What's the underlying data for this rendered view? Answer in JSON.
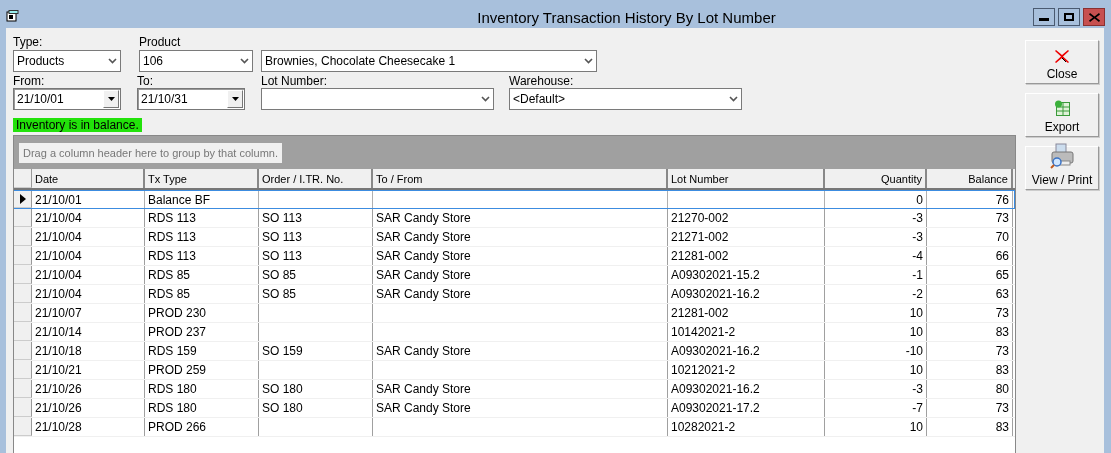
{
  "window": {
    "title": "Inventory Transaction History By Lot Number"
  },
  "filters": [
    [
      {
        "kind": "dropdown",
        "label": "Type:",
        "value": "Products"
      },
      {
        "kind": "dropdown",
        "label": "Product",
        "value": "106"
      },
      {
        "kind": "dropdown",
        "value": "Brownies, Chocolate Cheesecake 1"
      }
    ],
    [
      {
        "kind": "date",
        "label": "From:",
        "value": "21/10/01"
      },
      {
        "kind": "date",
        "label": "To:",
        "value": "21/10/31"
      },
      {
        "kind": "dropdown",
        "label": "Lot Number:"
      },
      {
        "kind": "dropdown",
        "label": "Warehouse:",
        "value": "<Default>"
      }
    ]
  ],
  "status": {
    "text": "Inventory is in balance.",
    "color": "#22e20a"
  },
  "grid": {
    "group_hint": "Drag a column header here to group by that column.",
    "columns": [
      {
        "label": "Date"
      },
      {
        "label": "Tx Type"
      },
      {
        "label": "Order / I.TR. No."
      },
      {
        "label": "To / From"
      },
      {
        "label": "Lot Number"
      },
      {
        "label": "Quantity"
      },
      {
        "label": "Balance"
      }
    ],
    "rows": [
      {
        "current": true,
        "cells": [
          "21/10/01",
          "Balance BF",
          null,
          null,
          null,
          "0",
          "76"
        ]
      },
      {
        "current": false,
        "cells": [
          "21/10/04",
          "RDS 113",
          "SO 113",
          "SAR Candy Store",
          "21270-002",
          "-3",
          "73"
        ]
      },
      {
        "current": false,
        "cells": [
          "21/10/04",
          "RDS 113",
          "SO 113",
          "SAR Candy Store",
          "21271-002",
          "-3",
          "70"
        ]
      },
      {
        "current": false,
        "cells": [
          "21/10/04",
          "RDS 113",
          "SO 113",
          "SAR Candy Store",
          "21281-002",
          "-4",
          "66"
        ]
      },
      {
        "current": false,
        "cells": [
          "21/10/04",
          "RDS 85",
          "SO 85",
          "SAR Candy Store",
          "A09302021-15.2",
          "-1",
          "65"
        ]
      },
      {
        "current": false,
        "cells": [
          "21/10/04",
          "RDS 85",
          "SO 85",
          "SAR Candy Store",
          "A09302021-16.2",
          "-2",
          "63"
        ]
      },
      {
        "current": false,
        "cells": [
          "21/10/07",
          "PROD 230",
          null,
          null,
          "21281-002",
          "10",
          "73"
        ]
      },
      {
        "current": false,
        "cells": [
          "21/10/14",
          "PROD 237",
          null,
          null,
          "10142021-2",
          "10",
          "83"
        ]
      },
      {
        "current": false,
        "cells": [
          "21/10/18",
          "RDS 159",
          "SO 159",
          "SAR Candy Store",
          "A09302021-16.2",
          "-10",
          "73"
        ]
      },
      {
        "current": false,
        "cells": [
          "21/10/21",
          "PROD 259",
          null,
          null,
          "10212021-2",
          "10",
          "83"
        ]
      },
      {
        "current": false,
        "cells": [
          "21/10/26",
          "RDS 180",
          "SO 180",
          "SAR Candy Store",
          "A09302021-16.2",
          "-3",
          "80"
        ]
      },
      {
        "current": false,
        "cells": [
          "21/10/26",
          "RDS 180",
          "SO 180",
          "SAR Candy Store",
          "A09302021-17.2",
          "-7",
          "73"
        ]
      },
      {
        "current": false,
        "cells": [
          "21/10/28",
          "PROD 266",
          null,
          null,
          "10282021-2",
          "10",
          "83"
        ]
      }
    ]
  },
  "buttons": [
    {
      "kind": "close",
      "label": "Close"
    },
    {
      "kind": "export",
      "label": "Export"
    },
    {
      "kind": "print",
      "label": "View / Print"
    }
  ]
}
